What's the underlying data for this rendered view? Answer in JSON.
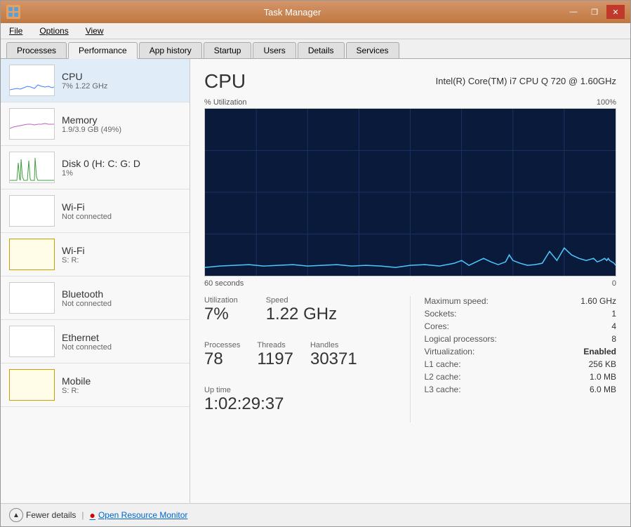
{
  "window": {
    "title": "Task Manager",
    "icon": "⚙"
  },
  "window_controls": {
    "minimize": "—",
    "restore": "❐",
    "close": "✕"
  },
  "menu": {
    "file": "File",
    "options": "Options",
    "view": "View"
  },
  "tabs": [
    {
      "id": "processes",
      "label": "Processes"
    },
    {
      "id": "performance",
      "label": "Performance",
      "active": true
    },
    {
      "id": "app-history",
      "label": "App history"
    },
    {
      "id": "startup",
      "label": "Startup"
    },
    {
      "id": "users",
      "label": "Users"
    },
    {
      "id": "details",
      "label": "Details"
    },
    {
      "id": "services",
      "label": "Services"
    }
  ],
  "sidebar": {
    "items": [
      {
        "id": "cpu",
        "name": "CPU",
        "sub": "7% 1.22 GHz",
        "active": true
      },
      {
        "id": "memory",
        "name": "Memory",
        "sub": "1.9/3.9 GB (49%)"
      },
      {
        "id": "disk",
        "name": "Disk 0 (H: C: G: D",
        "sub": "1%"
      },
      {
        "id": "wifi1",
        "name": "Wi-Fi",
        "sub": "Not connected"
      },
      {
        "id": "wifi2",
        "name": "Wi-Fi",
        "sub": "S: R:",
        "yellow": true
      },
      {
        "id": "bluetooth",
        "name": "Bluetooth",
        "sub": "Not connected"
      },
      {
        "id": "ethernet",
        "name": "Ethernet",
        "sub": "Not connected"
      },
      {
        "id": "mobile",
        "name": "Mobile",
        "sub": "S: R:",
        "yellow": true
      }
    ]
  },
  "main": {
    "cpu_label": "CPU",
    "cpu_model": "Intel(R) Core(TM) i7 CPU Q 720 @ 1.60GHz",
    "chart": {
      "y_label": "% Utilization",
      "y_max": "100%",
      "x_label": "60 seconds",
      "x_max": "0"
    },
    "utilization_label": "Utilization",
    "utilization_value": "7%",
    "speed_label": "Speed",
    "speed_value": "1.22 GHz",
    "processes_label": "Processes",
    "processes_value": "78",
    "threads_label": "Threads",
    "threads_value": "1197",
    "handles_label": "Handles",
    "handles_value": "30371",
    "uptime_label": "Up time",
    "uptime_value": "1:02:29:37",
    "details": [
      {
        "key": "Maximum speed:",
        "value": "1.60 GHz",
        "bold": false
      },
      {
        "key": "Sockets:",
        "value": "1",
        "bold": false
      },
      {
        "key": "Cores:",
        "value": "4",
        "bold": false
      },
      {
        "key": "Logical processors:",
        "value": "8",
        "bold": false
      },
      {
        "key": "Virtualization:",
        "value": "Enabled",
        "bold": true
      },
      {
        "key": "L1 cache:",
        "value": "256 KB",
        "bold": false
      },
      {
        "key": "L2 cache:",
        "value": "1.0 MB",
        "bold": false
      },
      {
        "key": "L3 cache:",
        "value": "6.0 MB",
        "bold": false
      }
    ]
  },
  "bottom": {
    "fewer_details": "Fewer details",
    "separator": "|",
    "resource_monitor": "Open Resource Monitor"
  }
}
